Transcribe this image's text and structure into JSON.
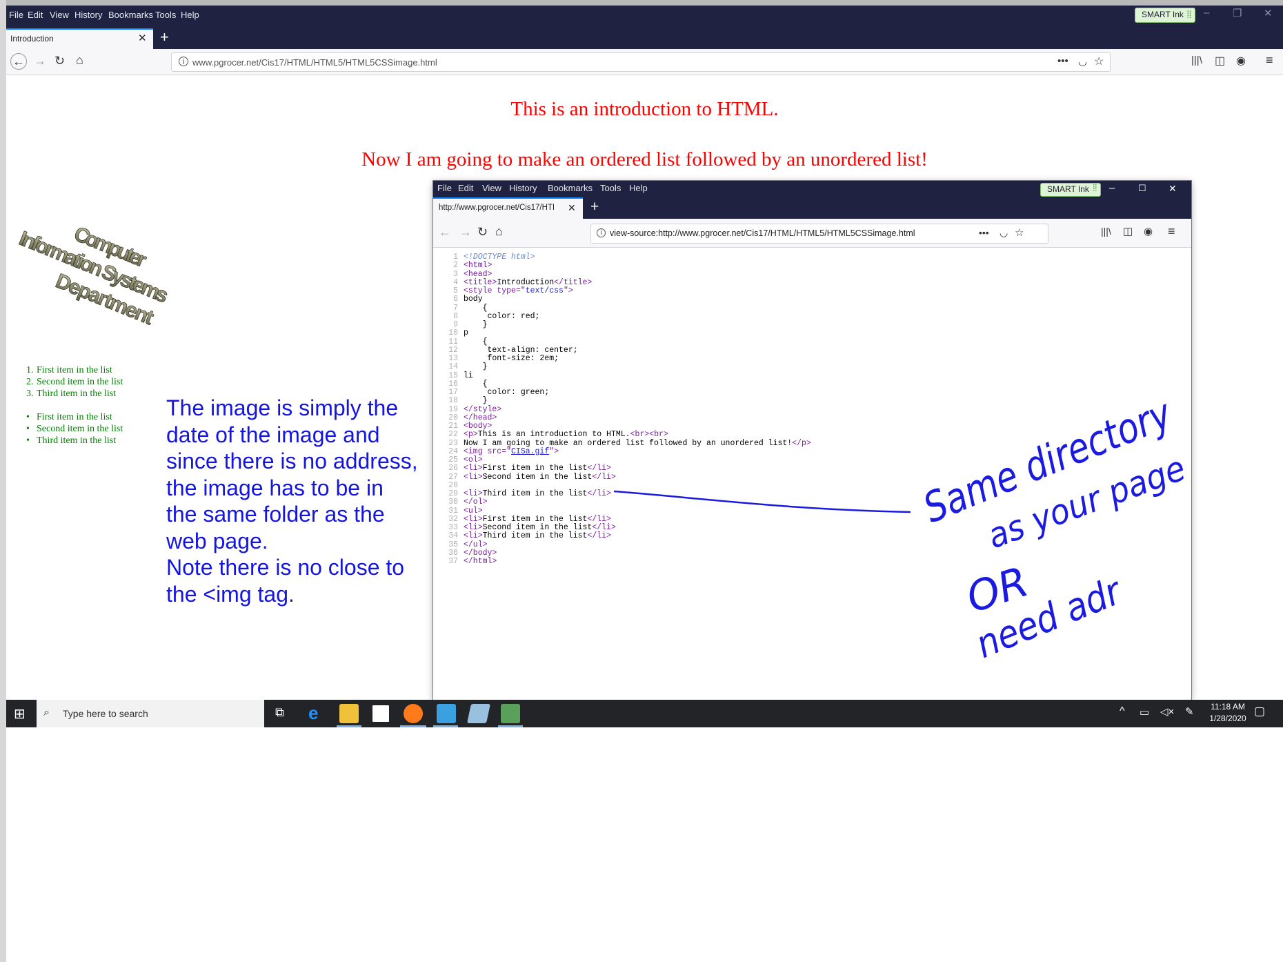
{
  "menu": [
    "File",
    "Edit",
    "View",
    "History",
    "Bookmarks",
    "Tools",
    "Help"
  ],
  "smart_ink": "SMART Ink",
  "tab": {
    "title": "Introduction",
    "close": "✕",
    "new": "+"
  },
  "url": {
    "text": "www.pgrocer.net/Cis17/HTML/HTML5/HTML5CSSimage.html"
  },
  "page": {
    "p1": "This is an introduction to HTML.",
    "p2": "Now I am going to make an ordered list followed by an unordered list!",
    "logo_words": [
      "Computer",
      "Information Systems",
      "Department"
    ],
    "ol": [
      "First item in the list",
      "Second item in the list",
      "Third item in the list"
    ],
    "ol_markers": [
      "1.",
      "2.",
      "3."
    ],
    "ul": [
      "First item in the list",
      "Second item in the list",
      "Third item in the list"
    ]
  },
  "note": [
    "The image is simply the",
    "date of the image and",
    "since there is no address,",
    "the image has to be in",
    "the same folder as the",
    "web page.",
    "Note there is no close to",
    "the <img tag."
  ],
  "inner": {
    "menu": [
      "File",
      "Edit",
      "View",
      "History",
      "Bookmarks",
      "Tools",
      "Help"
    ],
    "smart_ink": "SMART Ink",
    "tab_title": "http://www.pgrocer.net/Cis17/HTI",
    "url": "view-source:http://www.pgrocer.net/Cis17/HTML/HTML5/HTML5CSSimage.html",
    "code": [
      {
        "n": "1",
        "t": "<!DOCTYPE html>"
      },
      {
        "n": "2",
        "t": "<html>"
      },
      {
        "n": "3",
        "t": "<head>"
      },
      {
        "n": "4",
        "t": "<title>Introduction</title>"
      },
      {
        "n": "5",
        "t": "<style type=\"text/css\">"
      },
      {
        "n": "6",
        "t": "body"
      },
      {
        "n": "7",
        "t": "    {"
      },
      {
        "n": "8",
        "t": "     color: red;"
      },
      {
        "n": "9",
        "t": "    }"
      },
      {
        "n": "10",
        "t": "p"
      },
      {
        "n": "11",
        "t": "    {"
      },
      {
        "n": "12",
        "t": "     text-align: center;"
      },
      {
        "n": "13",
        "t": "     font-size: 2em;"
      },
      {
        "n": "14",
        "t": "    }"
      },
      {
        "n": "15",
        "t": "li"
      },
      {
        "n": "16",
        "t": "    {"
      },
      {
        "n": "17",
        "t": "     color: green;"
      },
      {
        "n": "18",
        "t": "    }"
      },
      {
        "n": "19",
        "t": "</style>"
      },
      {
        "n": "20",
        "t": "</head>"
      },
      {
        "n": "21",
        "t": "<body>"
      },
      {
        "n": "22",
        "t": "<p>This is an introduction to HTML.<br><br>"
      },
      {
        "n": "23",
        "t": "Now I am going to make an ordered list followed by an unordered list!</p>"
      },
      {
        "n": "24",
        "t": "<img src=\"CISa.gif\">"
      },
      {
        "n": "25",
        "t": "<ol>"
      },
      {
        "n": "26",
        "t": "<li>First item in the list</li>"
      },
      {
        "n": "27",
        "t": "<li>Second item in the list</li>"
      },
      {
        "n": "28",
        "t": ""
      },
      {
        "n": "29",
        "t": "<li>Third item in the list</li>"
      },
      {
        "n": "30",
        "t": "</ol>"
      },
      {
        "n": "31",
        "t": "<ul>"
      },
      {
        "n": "32",
        "t": "<li>First item in the list</li>"
      },
      {
        "n": "33",
        "t": "<li>Second item in the list</li>"
      },
      {
        "n": "34",
        "t": "<li>Third item in the list</li>"
      },
      {
        "n": "35",
        "t": "</ul>"
      },
      {
        "n": "36",
        "t": "</body>"
      },
      {
        "n": "37",
        "t": "</html>"
      }
    ]
  },
  "handwriting": [
    "Same directory",
    "as your page",
    "OR",
    "need adr"
  ],
  "taskbar": {
    "search_placeholder": "Type here to search",
    "time": "11:18 AM",
    "date": "1/28/2020"
  },
  "colors": {
    "page_text": "#ff0000",
    "list_text": "#008000",
    "note_text": "#1515e0",
    "chrome_dark": "#1f2240",
    "ink": "#1a1ae0"
  }
}
